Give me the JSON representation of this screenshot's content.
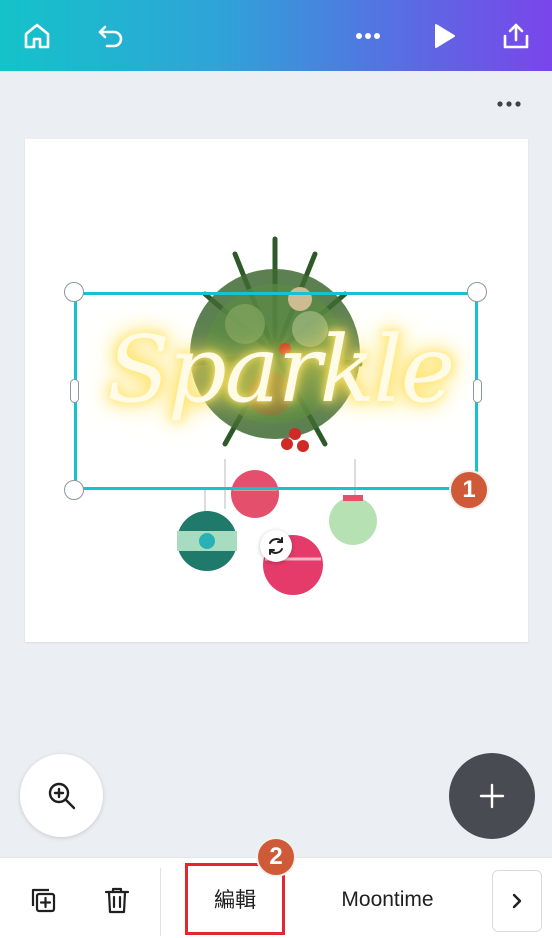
{
  "topbar": {
    "home_icon": "home-icon",
    "undo_icon": "undo-icon",
    "more_icon": "more-horizontal-icon",
    "play_icon": "play-icon",
    "share_icon": "share-icon",
    "gradient_start": "#14c3c9",
    "gradient_end": "#7a45ea"
  },
  "canvas": {
    "text_element": "Sparkle",
    "selection_color": "#16c1d2"
  },
  "badges": {
    "one": "1",
    "two": "2"
  },
  "bottombar": {
    "duplicate_icon": "duplicate-icon",
    "delete_icon": "trash-icon",
    "edit_label": "編輯",
    "font_label": "Moontime",
    "next_icon": "chevron-right-icon"
  }
}
